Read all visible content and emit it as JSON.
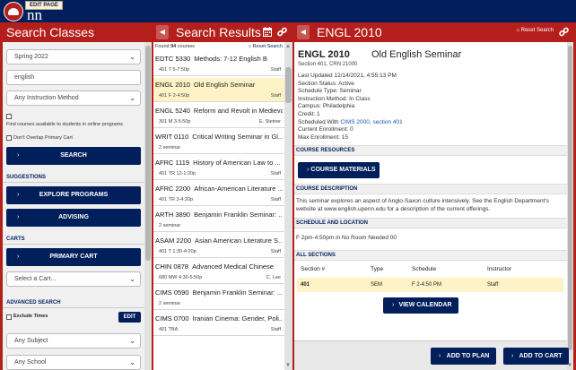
{
  "header": {
    "edit_tag": "EDIT PAGE",
    "logo_text": "nn"
  },
  "left": {
    "title": "Search Classes",
    "term": "Spring 2022",
    "keyword": "english",
    "method_placeholder": "Any Instruction Method",
    "online_text": "Find courses available to students in online programs",
    "no_overlap_label": "Don't Overlap Primary Cart",
    "search_button": "SEARCH",
    "suggestions_label": "SUGGESTIONS",
    "explore_button": "EXPLORE PROGRAMS",
    "advising_button": "ADVISING",
    "carts_label": "CARTS",
    "primary_cart_button": "PRIMARY CART",
    "select_cart_placeholder": "Select a Cart...",
    "advanced_label": "ADVANCED SEARCH",
    "exclude_times_label": "Exclude Times",
    "edit_button": "EDIT",
    "subject_placeholder": "Any Subject",
    "school_placeholder": "Any School"
  },
  "middle": {
    "title": "Search Results",
    "found_prefix": "Found ",
    "found_count": "94",
    "found_suffix": " courses",
    "reset_search": "Reset Search",
    "courses": [
      {
        "code": "EDTC 5330",
        "title": "Methods: 7-12 English B",
        "meta": "401   T 5-7:50p",
        "instructor": "Staff",
        "selected": false
      },
      {
        "code": "ENGL 2010",
        "title": "Old English Seminar",
        "meta": "401   F 2-4:50p",
        "instructor": "Staff",
        "selected": true
      },
      {
        "code": "ENGL 5240",
        "title": "Reform and Revolt in Medieval...",
        "meta": "301   M 3-5:50p",
        "instructor": "E. Steiner",
        "selected": false
      },
      {
        "code": "WRIT 0110",
        "title": "Critical Writing Seminar in Gl...",
        "meta": "2 seminar",
        "instructor": "",
        "selected": false
      },
      {
        "code": "AFRC 1119",
        "title": "History of American Law to ...",
        "meta": "401   TR 12-1:20p",
        "instructor": "Staff",
        "selected": false
      },
      {
        "code": "AFRC 2200",
        "title": "African-American Literature ...",
        "meta": "401   TR 3-4:20p",
        "instructor": "Staff",
        "selected": false
      },
      {
        "code": "ARTH 3890",
        "title": "Benjamin Franklin Seminar: ...",
        "meta": "2 seminar",
        "instructor": "",
        "selected": false
      },
      {
        "code": "ASAM 2200",
        "title": "Asian American Literature S...",
        "meta": "401   T 1:30-4:20p",
        "instructor": "Staff",
        "selected": false
      },
      {
        "code": "CHIN 0878",
        "title": "Advanced Medical Chinese",
        "meta": "680   MW 4:30-5:50p",
        "instructor": "C. Lee",
        "selected": false
      },
      {
        "code": "CIMS 0590",
        "title": "Benjamin Franklin Seminar: ...",
        "meta": "2 seminar",
        "instructor": "",
        "selected": false
      },
      {
        "code": "CIMS 0700",
        "title": "Iranian Cinema: Gender, Poli...",
        "meta": "401   TBA",
        "instructor": "Staff",
        "selected": false
      }
    ]
  },
  "right": {
    "title": "ENGL 2010",
    "reset_search": "Reset Search",
    "course_code": "ENGL 2010",
    "course_title": "Old English Seminar",
    "section_line": "Section 401, CRN 21000",
    "details_prefix": [
      "Last Updated 12/14/2021, 4:55:13 PM",
      "Section Status: Active",
      "Schedule Type: Seminar",
      "Instruction Method: In Class",
      "Campus: Philadelphia",
      "Credit: 1"
    ],
    "scheduled_with_prefix": "Scheduled With ",
    "scheduled_with_links": "CIMS 2000, section 401",
    "details_suffix": [
      "Current Enrollment: 0",
      "Max Enrollment: 15"
    ],
    "resources_label": "COURSE RESOURCES",
    "materials_button": "COURSE MATERIALS",
    "description_label": "COURSE DESCRIPTION",
    "description_text": "This seminar explores an aspect of Anglo-Saxon culture intensively. See the English Department's website at www.english.upenn.edu for a description of the current offerings.",
    "schedule_label": "SCHEDULE AND LOCATION",
    "schedule_text": "F 2pm-4:50pm in No Room Needed 00",
    "sections_label": "ALL SECTIONS",
    "sections_headers": [
      "Section #",
      "Type",
      "Schedule",
      "Instructor"
    ],
    "sections_rows": [
      [
        "401",
        "SEM",
        "F 2-4:50 PM",
        "Staff"
      ]
    ],
    "calendar_button": "VIEW CALENDAR",
    "add_plan_button": "ADD TO PLAN",
    "add_cart_button": "ADD TO CART"
  },
  "colors": {
    "brand_red": "#b41f1c",
    "brand_navy": "#011f5b",
    "selected_row": "#fdf3c7",
    "link_blue": "#1a57b8"
  }
}
